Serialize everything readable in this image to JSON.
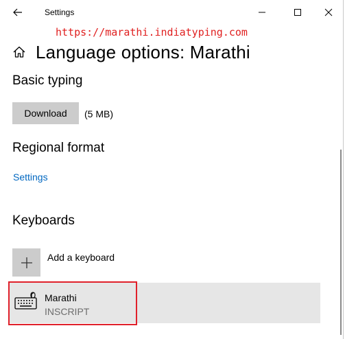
{
  "titlebar": {
    "title": "Settings",
    "icons": {
      "back": "back-arrow-icon",
      "minimize": "minimize-icon",
      "maximize": "maximize-icon",
      "close": "close-icon"
    }
  },
  "watermark": {
    "text": "https://marathi.indiatyping.com",
    "color": "#e02020"
  },
  "header": {
    "title": "Language options: Marathi",
    "icon": "home-icon"
  },
  "basic_typing": {
    "heading": "Basic typing",
    "download_label": "Download",
    "size": "(5 MB)"
  },
  "regional_format": {
    "heading": "Regional format",
    "settings_link": "Settings"
  },
  "keyboards": {
    "heading": "Keyboards",
    "add_label": "Add a keyboard",
    "items": [
      {
        "name": "Marathi",
        "layout": "INSCRIPT",
        "icon": "keyboard-icon"
      }
    ]
  },
  "colors": {
    "accent": "#0067c0",
    "highlight_border": "#e0202a",
    "button_bg": "#cccccc",
    "row_bg": "#e6e6e6"
  }
}
